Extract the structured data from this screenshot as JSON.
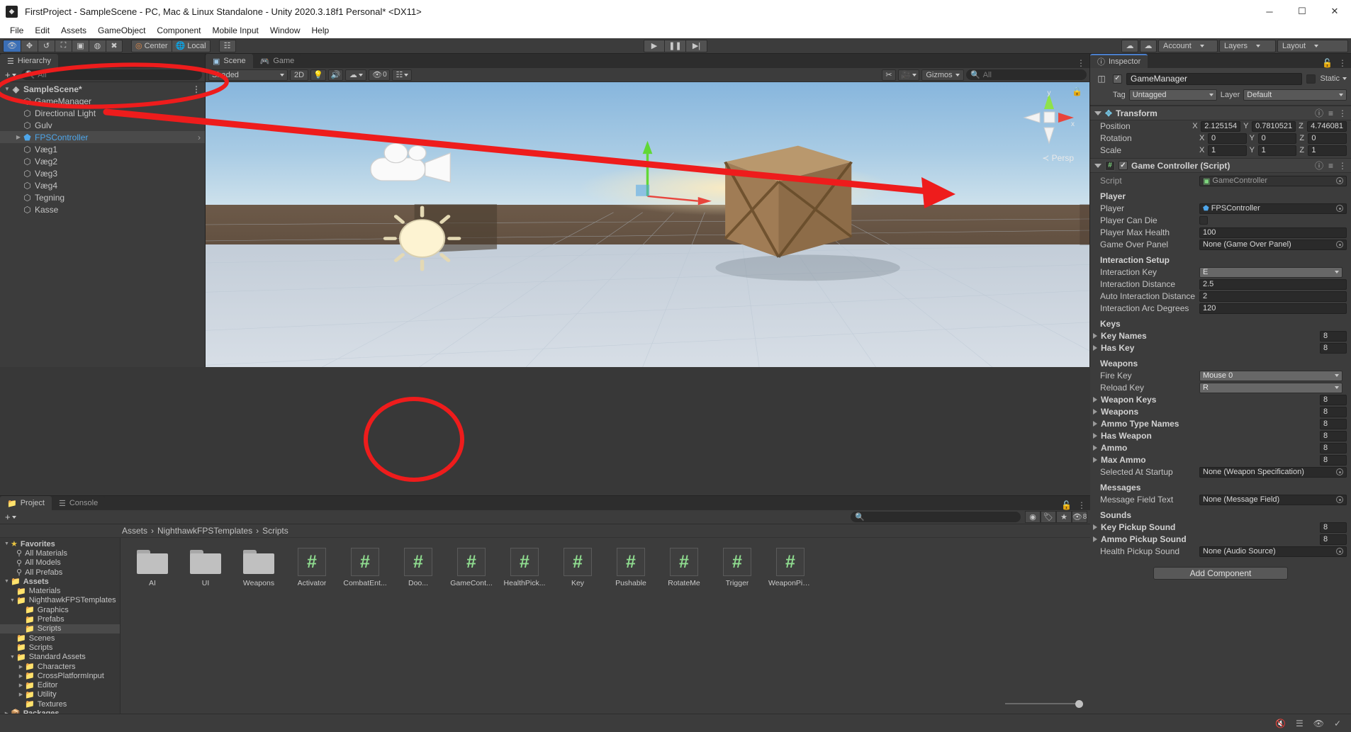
{
  "window": {
    "title": "FirstProject - SampleScene - PC, Mac & Linux Standalone - Unity 2020.3.18f1 Personal* <DX11>",
    "minimize": "─",
    "maximize": "☐",
    "close": "✕"
  },
  "menubar": [
    "File",
    "Edit",
    "Assets",
    "GameObject",
    "Component",
    "Mobile Input",
    "Window",
    "Help"
  ],
  "toolbar": {
    "tools": [
      "hand-tool",
      "move-tool",
      "rotate-tool",
      "scale-tool",
      "rect-tool",
      "transform-tool",
      "custom-tool"
    ],
    "pivot_mode": "Center",
    "pivot_rotation": "Local",
    "grid_label": "grid-snap",
    "play": "▶",
    "pause": "❚❚",
    "step": "▶|",
    "collab": "collab-icon",
    "cloud": "cloud-icon",
    "account": "Account",
    "layers": "Layers",
    "layout": "Layout"
  },
  "hierarchy": {
    "tab": "Hierarchy",
    "search_placeholder": "All",
    "plus": "+",
    "items": [
      {
        "label": "SampleScene*",
        "indent": 0,
        "icon": "scene-icon",
        "expanded": true,
        "selected": false,
        "blue": false
      },
      {
        "label": "GameManager",
        "indent": 1,
        "icon": "gameobject-icon",
        "expanded": null,
        "selected": false,
        "blue": false
      },
      {
        "label": "Directional Light",
        "indent": 1,
        "icon": "gameobject-icon",
        "expanded": null,
        "selected": false,
        "blue": false
      },
      {
        "label": "Gulv",
        "indent": 1,
        "icon": "gameobject-icon",
        "expanded": null,
        "selected": false,
        "blue": false
      },
      {
        "label": "FPSController",
        "indent": 1,
        "icon": "prefab-icon",
        "expanded": false,
        "selected": true,
        "blue": true
      },
      {
        "label": "Væg1",
        "indent": 1,
        "icon": "gameobject-icon",
        "expanded": null,
        "selected": false,
        "blue": false
      },
      {
        "label": "Væg2",
        "indent": 1,
        "icon": "gameobject-icon",
        "expanded": null,
        "selected": false,
        "blue": false
      },
      {
        "label": "Væg3",
        "indent": 1,
        "icon": "gameobject-icon",
        "expanded": null,
        "selected": false,
        "blue": false
      },
      {
        "label": "Væg4",
        "indent": 1,
        "icon": "gameobject-icon",
        "expanded": null,
        "selected": false,
        "blue": false
      },
      {
        "label": "Tegning",
        "indent": 1,
        "icon": "gameobject-icon",
        "expanded": null,
        "selected": false,
        "blue": false
      },
      {
        "label": "Kasse",
        "indent": 1,
        "icon": "gameobject-icon",
        "expanded": null,
        "selected": false,
        "blue": false
      }
    ]
  },
  "scene": {
    "tabs": [
      {
        "label": "Scene",
        "active": true,
        "icon": "scene-tab-icon"
      },
      {
        "label": "Game",
        "active": false,
        "icon": "game-tab-icon"
      }
    ],
    "shading_mode": "Shaded",
    "mode_2d": "2D",
    "gizmos_label": "Gizmos",
    "search_placeholder": "All",
    "audio_icon": "audio-icon",
    "lighting_icon": "lighting-icon",
    "fx_icon": "effects-icon",
    "overlay_count": "0",
    "camera_icon": "scene-camera-icon",
    "projection": "Persp",
    "axis_x": "x",
    "axis_y": "y"
  },
  "inspector": {
    "tab": "Inspector",
    "object_name": "GameManager",
    "enabled": true,
    "static_label": "Static",
    "tag_label": "Tag",
    "tag_value": "Untagged",
    "layer_label": "Layer",
    "layer_value": "Default",
    "transform": {
      "title": "Transform",
      "rows": [
        {
          "name": "Position",
          "x": "2.125154",
          "y": "0.7810521",
          "z": "4.746081"
        },
        {
          "name": "Rotation",
          "x": "0",
          "y": "0",
          "z": "0"
        },
        {
          "name": "Scale",
          "x": "1",
          "y": "1",
          "z": "1"
        }
      ],
      "axis_labels": [
        "X",
        "Y",
        "Z"
      ]
    },
    "game_controller": {
      "title": "Game Controller (Script)",
      "enabled": true,
      "script_label": "Script",
      "script_value": "GameController",
      "sections": [
        {
          "heading": "Player",
          "fields": [
            {
              "type": "object",
              "name": "Player",
              "value": "FPSController",
              "icon": "prefab-icon"
            },
            {
              "type": "checkbox",
              "name": "Player Can Die",
              "value": false
            },
            {
              "type": "text",
              "name": "Player Max Health",
              "value": "100"
            },
            {
              "type": "object",
              "name": "Game Over Panel",
              "value": "None (Game Over Panel)",
              "icon": null
            }
          ]
        },
        {
          "heading": "Interaction Setup",
          "fields": [
            {
              "type": "dropdown",
              "name": "Interaction Key",
              "value": "E"
            },
            {
              "type": "text",
              "name": "Interaction Distance",
              "value": "2.5"
            },
            {
              "type": "text",
              "name": "Auto Interaction Distance",
              "value": "2"
            },
            {
              "type": "text",
              "name": "Interaction Arc Degrees",
              "value": "120"
            }
          ]
        },
        {
          "heading": "Keys",
          "fields": [
            {
              "type": "array",
              "name": "Key Names",
              "value": "8"
            },
            {
              "type": "array",
              "name": "Has Key",
              "value": "8"
            }
          ]
        },
        {
          "heading": "Weapons",
          "fields": [
            {
              "type": "dropdown",
              "name": "Fire Key",
              "value": "Mouse 0"
            },
            {
              "type": "dropdown",
              "name": "Reload Key",
              "value": "R"
            },
            {
              "type": "array",
              "name": "Weapon Keys",
              "value": "8"
            },
            {
              "type": "array",
              "name": "Weapons",
              "value": "8"
            },
            {
              "type": "array",
              "name": "Ammo Type Names",
              "value": "8"
            },
            {
              "type": "array",
              "name": "Has Weapon",
              "value": "8"
            },
            {
              "type": "array",
              "name": "Ammo",
              "value": "8"
            },
            {
              "type": "array",
              "name": "Max Ammo",
              "value": "8"
            },
            {
              "type": "object",
              "name": "Selected At Startup",
              "value": "None (Weapon Specification)",
              "icon": null
            }
          ]
        },
        {
          "heading": "Messages",
          "fields": [
            {
              "type": "object",
              "name": "Message Field Text",
              "value": "None (Message Field)",
              "icon": null
            }
          ]
        },
        {
          "heading": "Sounds",
          "fields": [
            {
              "type": "array",
              "name": "Key Pickup Sound",
              "value": "8"
            },
            {
              "type": "array",
              "name": "Ammo Pickup Sound",
              "value": "8"
            },
            {
              "type": "object",
              "name": "Health Pickup Sound",
              "value": "None (Audio Source)",
              "icon": null
            }
          ]
        }
      ]
    },
    "add_component": "Add Component"
  },
  "project": {
    "tabs": [
      {
        "label": "Project",
        "active": true,
        "icon": "project-tab-icon"
      },
      {
        "label": "Console",
        "active": false,
        "icon": "console-tab-icon"
      }
    ],
    "plus": "+",
    "search_placeholder": "",
    "hidden_count": "8",
    "breadcrumb": [
      "Assets",
      "NighthawkFPSTemplates",
      "Scripts"
    ],
    "tree": [
      {
        "label": "Favorites",
        "indent": 0,
        "icon": "star-icon",
        "arrow": "down",
        "bold": true,
        "selected": false
      },
      {
        "label": "All Materials",
        "indent": 1,
        "icon": "search-icon",
        "arrow": null,
        "bold": false,
        "selected": false
      },
      {
        "label": "All Models",
        "indent": 1,
        "icon": "search-icon",
        "arrow": null,
        "bold": false,
        "selected": false
      },
      {
        "label": "All Prefabs",
        "indent": 1,
        "icon": "search-icon",
        "arrow": null,
        "bold": false,
        "selected": false
      },
      {
        "label": "Assets",
        "indent": 0,
        "icon": "folder-icon",
        "arrow": "down",
        "bold": true,
        "selected": false
      },
      {
        "label": "Materials",
        "indent": 1,
        "icon": "folder-icon",
        "arrow": null,
        "bold": false,
        "selected": false
      },
      {
        "label": "NighthawkFPSTemplates",
        "indent": 1,
        "icon": "folder-icon",
        "arrow": "down",
        "bold": false,
        "selected": false
      },
      {
        "label": "Graphics",
        "indent": 2,
        "icon": "folder-icon",
        "arrow": null,
        "bold": false,
        "selected": false
      },
      {
        "label": "Prefabs",
        "indent": 2,
        "icon": "folder-icon",
        "arrow": null,
        "bold": false,
        "selected": false
      },
      {
        "label": "Scripts",
        "indent": 2,
        "icon": "folder-icon",
        "arrow": null,
        "bold": false,
        "selected": true
      },
      {
        "label": "Scenes",
        "indent": 1,
        "icon": "folder-icon",
        "arrow": null,
        "bold": false,
        "selected": false
      },
      {
        "label": "Scripts",
        "indent": 1,
        "icon": "folder-icon",
        "arrow": null,
        "bold": false,
        "selected": false
      },
      {
        "label": "Standard Assets",
        "indent": 1,
        "icon": "folder-icon",
        "arrow": "down",
        "bold": false,
        "selected": false
      },
      {
        "label": "Characters",
        "indent": 2,
        "icon": "folder-icon",
        "arrow": "right",
        "bold": false,
        "selected": false
      },
      {
        "label": "CrossPlatformInput",
        "indent": 2,
        "icon": "folder-icon",
        "arrow": "right",
        "bold": false,
        "selected": false
      },
      {
        "label": "Editor",
        "indent": 2,
        "icon": "folder-icon",
        "arrow": "right",
        "bold": false,
        "selected": false
      },
      {
        "label": "Utility",
        "indent": 2,
        "icon": "folder-icon",
        "arrow": "right",
        "bold": false,
        "selected": false
      },
      {
        "label": "Textures",
        "indent": 2,
        "icon": "folder-icon",
        "arrow": null,
        "bold": false,
        "selected": false
      },
      {
        "label": "Packages",
        "indent": 0,
        "icon": "package-icon",
        "arrow": "right",
        "bold": true,
        "selected": false
      }
    ],
    "assets": [
      {
        "label": "AI",
        "kind": "folder"
      },
      {
        "label": "UI",
        "kind": "folder"
      },
      {
        "label": "Weapons",
        "kind": "folder"
      },
      {
        "label": "Activator",
        "kind": "script"
      },
      {
        "label": "CombatEnt...",
        "kind": "script"
      },
      {
        "label": "Doo...",
        "kind": "script"
      },
      {
        "label": "GameCont...",
        "kind": "script"
      },
      {
        "label": "HealthPick...",
        "kind": "script"
      },
      {
        "label": "Key",
        "kind": "script"
      },
      {
        "label": "Pushable",
        "kind": "script"
      },
      {
        "label": "RotateMe",
        "kind": "script"
      },
      {
        "label": "Trigger",
        "kind": "script"
      },
      {
        "label": "WeaponPic...",
        "kind": "script"
      }
    ],
    "script_glyph": "#"
  },
  "statusbar": {
    "icons": [
      "mute-audio-icon",
      "layers-stats-icon",
      "hidden-objects-icon",
      "ready-icon"
    ]
  },
  "annotations": {
    "colors": {
      "highlight": "#ee1c1c"
    },
    "ellipse_hierarchy": "circle around SampleScene / GameManager rows",
    "arrow": "arrow from hierarchy FPSController to inspector Player field",
    "ellipse_project": "circle around GameController script asset"
  },
  "colors": {
    "panel_bg": "#3c3c3c",
    "header_bg": "#414141",
    "field_bg": "#2a2a2a",
    "selection": "#4a4a4a",
    "accent_blue": "#4ea6ea",
    "script_green": "#8fdc8f",
    "annotation_red": "#ee1c1c"
  }
}
